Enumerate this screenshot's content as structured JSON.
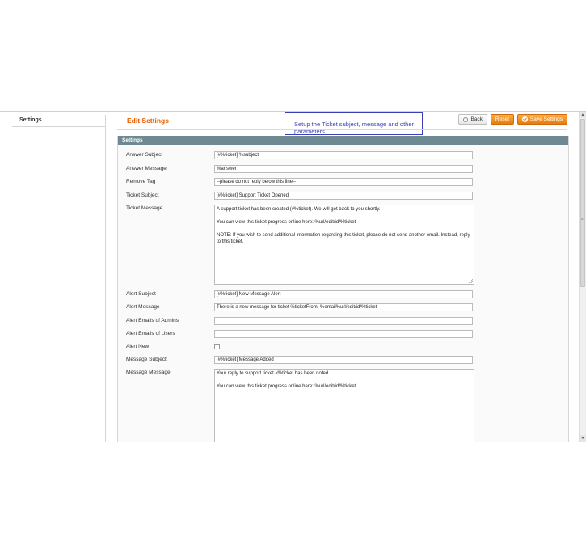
{
  "sidebar": {
    "title": "Settings"
  },
  "header": {
    "title": "Edit Settings",
    "tooltip": "Setup the Ticket subject, message and other parameters",
    "back_label": "Back",
    "reset_label": "Reset",
    "save_label": "Save Settings"
  },
  "fieldset": {
    "title": "Settings",
    "fields": {
      "answer_subject": {
        "label": "Answer Subject",
        "value": "[#%ticket] %subject"
      },
      "answer_message": {
        "label": "Answer Message",
        "value": "%answer"
      },
      "remove_tag": {
        "label": "Remove Tag",
        "value": "--please do not reply below this line--"
      },
      "ticket_subject": {
        "label": "Ticket Subject",
        "value": "[#%ticket] Support Ticket Opened"
      },
      "ticket_message": {
        "label": "Ticket Message",
        "line1": "A support ticket has been created (#%ticket). We will get back to you shortly.",
        "line2": "You can view this ticket progress online here: %url/edit/id/%ticket",
        "line3": "NOTE: If you wish to send additional information regarding this ticket, please do not send another email. Instead, reply to this ticket."
      },
      "alert_subject": {
        "label": "Alert Subject",
        "value": "[#%ticket] New Message Alert"
      },
      "alert_message": {
        "label": "Alert Message",
        "value": "There is a new message for ticket %ticketFrom: %email%url/edit/id/%ticket"
      },
      "alert_emails_admins": {
        "label": "Alert Emails of Admins",
        "value": ""
      },
      "alert_emails_users": {
        "label": "Alert Emails of Users",
        "value": ""
      },
      "alert_new": {
        "label": "Alert New",
        "checked": false
      },
      "message_subject": {
        "label": "Message Subject",
        "value": "[#%ticket] Message Added"
      },
      "message_message": {
        "label": "Message Message",
        "line1": "Your reply to support ticket #%ticket has been noted.",
        "line2": "You can view this ticket progress online here: %url/edit/id/%ticket"
      }
    }
  },
  "colors": {
    "accent": "#eb5e00",
    "fieldset_header": "#6f8992",
    "tooltip_border": "#3b3fb5"
  }
}
